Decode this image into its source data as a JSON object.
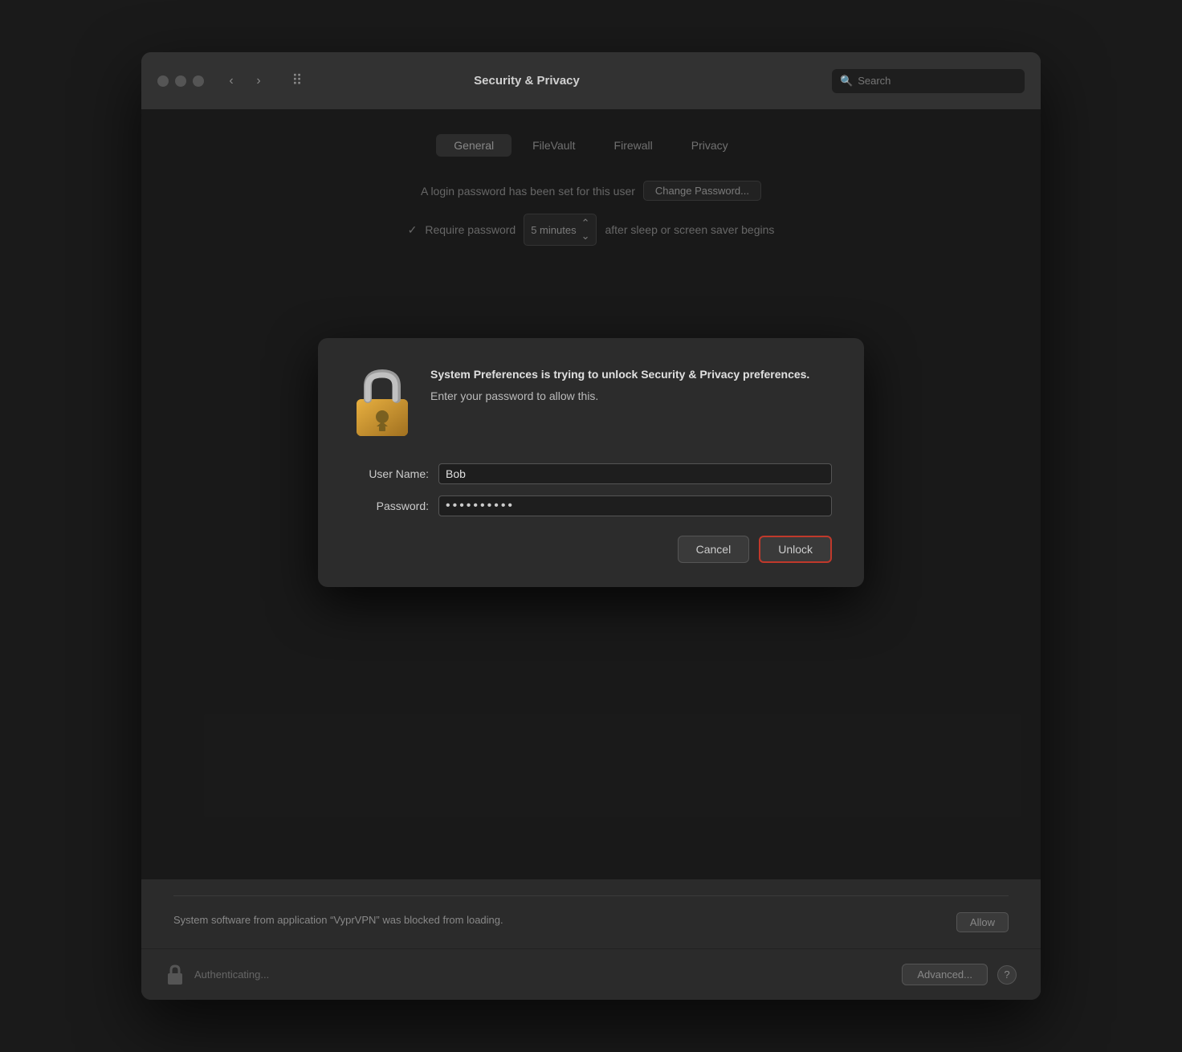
{
  "window": {
    "title": "Security & Privacy",
    "search_placeholder": "Search"
  },
  "traffic_lights": {
    "close": "close",
    "minimize": "minimize",
    "maximize": "maximize"
  },
  "tabs": [
    {
      "label": "General",
      "active": true
    },
    {
      "label": "FileVault",
      "active": false
    },
    {
      "label": "Firewall",
      "active": false
    },
    {
      "label": "Privacy",
      "active": false
    }
  ],
  "password_row": {
    "text": "A login password has been set for this user",
    "button_label": "Change Password..."
  },
  "require_password": {
    "label": "Require password",
    "dropdown_value": "5 minutes",
    "suffix": "after sleep or screen saver begins"
  },
  "dialog": {
    "title": "System Preferences is trying to unlock Security &\nPrivacy preferences.",
    "subtitle": "Enter your password to allow this.",
    "username_label": "User Name:",
    "username_value": "Bob",
    "password_label": "Password:",
    "password_dots": "●●●●●●●●●●",
    "cancel_label": "Cancel",
    "unlock_label": "Unlock"
  },
  "bottom": {
    "allow_text": "System software from application “VyprVPN” was blocked\nfrom loading.",
    "allow_button": "Allow"
  },
  "footer": {
    "auth_text": "Authenticating...",
    "advanced_label": "Advanced...",
    "help_label": "?"
  }
}
